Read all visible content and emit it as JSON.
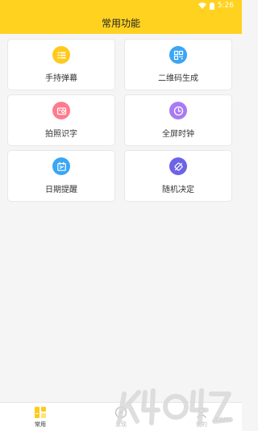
{
  "status_bar": {
    "time": "5:26"
  },
  "app_bar": {
    "title": "常用功能"
  },
  "features": [
    {
      "label": "手持弹幕",
      "icon": "barrage-list-icon",
      "color": "#ffca1e"
    },
    {
      "label": "二维码生成",
      "icon": "qr-code-icon",
      "color": "#3aa6f4"
    },
    {
      "label": "拍照识字",
      "icon": "photo-text-icon",
      "color": "#ff7b8e"
    },
    {
      "label": "全屏时钟",
      "icon": "clock-icon",
      "color": "#a97bf2"
    },
    {
      "label": "日期提醒",
      "icon": "calendar-icon",
      "color": "#3aa6f4"
    },
    {
      "label": "随机决定",
      "icon": "random-die-icon",
      "color": "#6c63e6"
    }
  ],
  "tabs": [
    {
      "label": "常用",
      "active": true
    },
    {
      "label": "发现",
      "active": false
    },
    {
      "label": "我的",
      "active": false
    }
  ],
  "colors": {
    "brand": "#ffd21f",
    "tab_active_icon": "#ffca1e",
    "tab_inactive": "#bdbdbd"
  },
  "watermark": {
    "text": "k73.com"
  }
}
